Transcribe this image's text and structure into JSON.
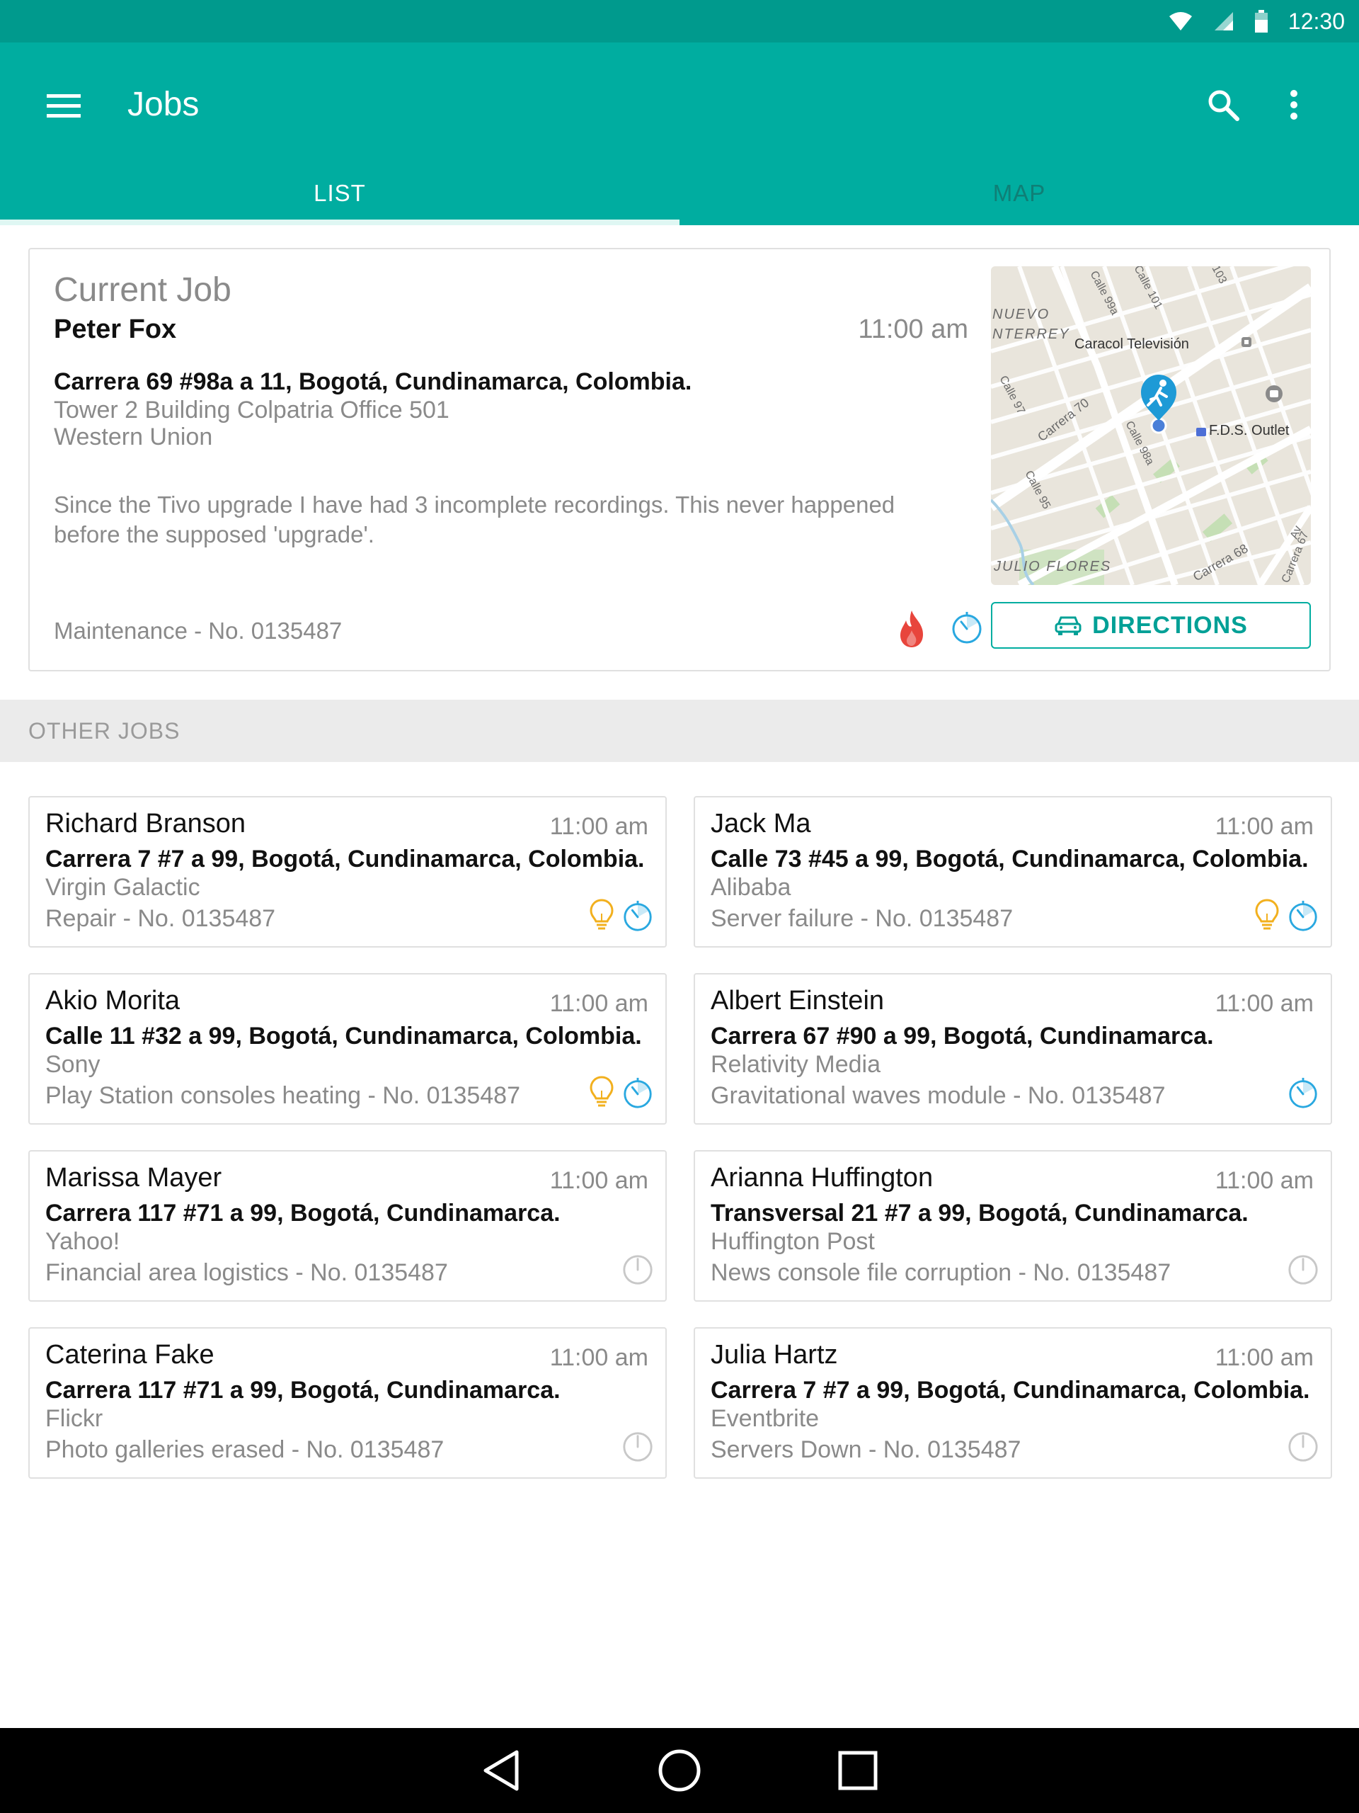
{
  "status_bar": {
    "time": "12:30"
  },
  "app_bar": {
    "title": "Jobs"
  },
  "tabs": [
    {
      "label": "LIST",
      "active": true
    },
    {
      "label": "MAP",
      "active": false
    }
  ],
  "current_job": {
    "heading": "Current Job",
    "name": "Peter Fox",
    "time": "11:00 am",
    "address": "Carrera 69 #98a a 11, Bogotá, Cundinamarca, Colombia.",
    "location_line1": "Tower 2 Building Colpatria Office 501",
    "location_line2": "Western Union",
    "description": "Since the Tivo upgrade I have had 3 incomplete recordings. This never happened before the supposed 'upgrade'.",
    "footer": "Maintenance - No. 0135487",
    "directions_label": "DIRECTIONS",
    "map_labels": {
      "nuevo": "NUEVO",
      "monterrey": "NTERREY",
      "caracol": "Caracol Televisión",
      "outlet": "F.D.S. Outlet",
      "julio_flores": "JULIO FLORES",
      "calle99a": "Calle 99a",
      "calle101": "Calle 101",
      "calle103": "103",
      "carrera70": "Carrera 70",
      "calle97": "Calle 97",
      "calle98a": "Calle 98a",
      "calle95": "Calle 95",
      "carrera68": "Carrera 68",
      "carrera67": "Carrera 67",
      "av": "Av"
    }
  },
  "other_jobs_title": "OTHER JOBS",
  "jobs": [
    {
      "name": "Richard Branson",
      "time": "11:00 am",
      "address": "Carrera 7 #7 a 99, Bogotá, Cundinamarca, Colombia.",
      "company": "Virgin Galactic",
      "footer": "Repair - No. 0135487",
      "bulb": true,
      "status": "active"
    },
    {
      "name": "Jack Ma",
      "time": "11:00 am",
      "address": "Calle 73 #45 a 99, Bogotá, Cundinamarca, Colombia.",
      "company": "Alibaba",
      "footer": "Server failure - No. 0135487",
      "bulb": true,
      "status": "active"
    },
    {
      "name": "Akio Morita",
      "time": "11:00 am",
      "address": "Calle 11 #32 a 99, Bogotá, Cundinamarca, Colombia.",
      "company": "Sony",
      "footer": "Play Station consoles heating - No. 0135487",
      "bulb": true,
      "status": "active"
    },
    {
      "name": "Albert Einstein",
      "time": "11:00 am",
      "address": "Carrera 67 #90 a 99, Bogotá, Cundinamarca.",
      "company": "Relativity Media",
      "footer": "Gravitational waves module - No. 0135487",
      "bulb": false,
      "status": "active"
    },
    {
      "name": "Marissa Mayer",
      "time": "11:00 am",
      "address": "Carrera 117 #71 a 99, Bogotá, Cundinamarca.",
      "company": "Yahoo!",
      "footer": "Financial area logistics - No. 0135487",
      "bulb": false,
      "status": "idle"
    },
    {
      "name": "Arianna Huffington",
      "time": "11:00 am",
      "address": "Transversal 21 #7 a 99, Bogotá, Cundinamarca.",
      "company": "Huffington Post",
      "footer": "News console file corruption - No. 0135487",
      "bulb": false,
      "status": "idle"
    },
    {
      "name": "Caterina Fake",
      "time": "11:00 am",
      "address": "Carrera 117 #71 a 99, Bogotá, Cundinamarca.",
      "company": "Flickr",
      "footer": "Photo galleries erased - No. 0135487",
      "bulb": false,
      "status": "idle"
    },
    {
      "name": "Julia Hartz",
      "time": "11:00 am",
      "address": "Carrera 7 #7 a 99, Bogotá, Cundinamarca, Colombia.",
      "company": "Eventbrite",
      "footer": "Servers Down - No. 0135487",
      "bulb": false,
      "status": "idle"
    }
  ],
  "icons": {
    "menu": "menu-icon",
    "search": "search-icon",
    "more": "more-vert-icon",
    "priority": "flame-icon",
    "status": "timer-icon",
    "bulb": "lightbulb-icon",
    "car": "car-icon",
    "back": "back-icon",
    "home": "home-icon",
    "recents": "recents-icon",
    "wifi": "wifi-icon",
    "signal": "signal-icon",
    "battery": "battery-icon"
  },
  "colors": {
    "primary": "#00ada0",
    "primary_dark": "#009a8d",
    "accent_blue": "#29a8e0",
    "flame": "#e8453c",
    "bulb": "#f2b01e",
    "idle": "#c8c8c8"
  }
}
